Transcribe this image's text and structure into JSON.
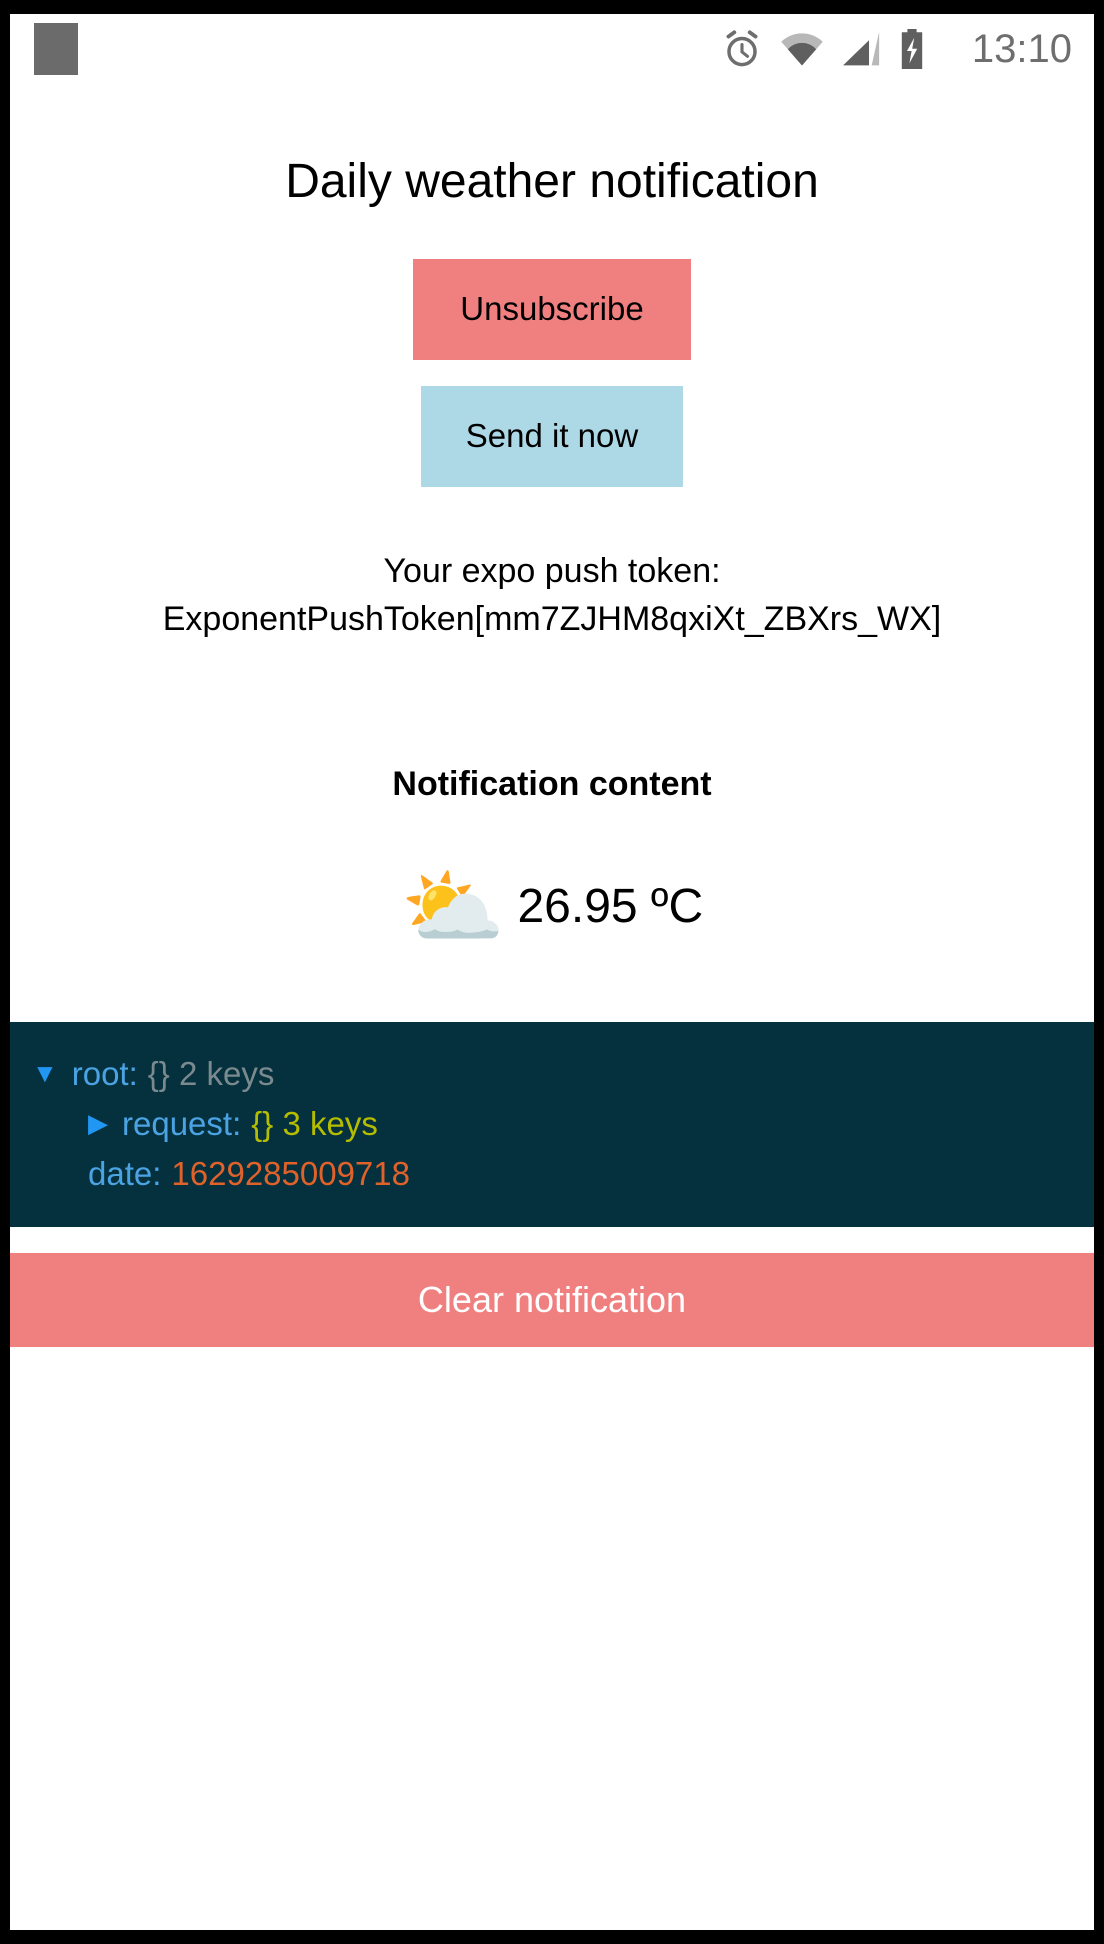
{
  "status_bar": {
    "app_icon": "app-square-icon",
    "icons": [
      "alarm-icon",
      "wifi-icon",
      "cellular-signal-icon",
      "battery-charging-icon"
    ],
    "time": "13:10"
  },
  "screen": {
    "title": "Daily weather notification",
    "buttons": {
      "unsubscribe": "Unsubscribe",
      "send_now": "Send it now"
    },
    "token": {
      "label": "Your expo push token:",
      "value": "ExponentPushToken[mm7ZJHM8qxiXt_ZBXrs_WX]"
    },
    "notification": {
      "heading": "Notification content",
      "emoji": "⛅",
      "emoji_name": "sun-behind-cloud-icon",
      "temperature": "26.95 ºC"
    }
  },
  "json_viewer": {
    "rows": [
      {
        "caret": "▼",
        "key": "root:",
        "brace": "{}",
        "count": "2 keys",
        "value": ""
      },
      {
        "caret": "▶",
        "key": "request:",
        "brace": "{}",
        "count": "3 keys",
        "value": ""
      },
      {
        "caret": "",
        "key": "date:",
        "brace": "",
        "count": "",
        "value": "1629285009718"
      }
    ]
  },
  "bottom": {
    "clear_label": "Clear notification"
  },
  "colors": {
    "danger": "#f08080",
    "info": "#add8e6",
    "panel_bg": "#04313d",
    "json_key": "#4ba3e3",
    "json_gray": "#7b8a8f",
    "json_olive": "#b5bd00",
    "json_number": "#e0622a"
  }
}
